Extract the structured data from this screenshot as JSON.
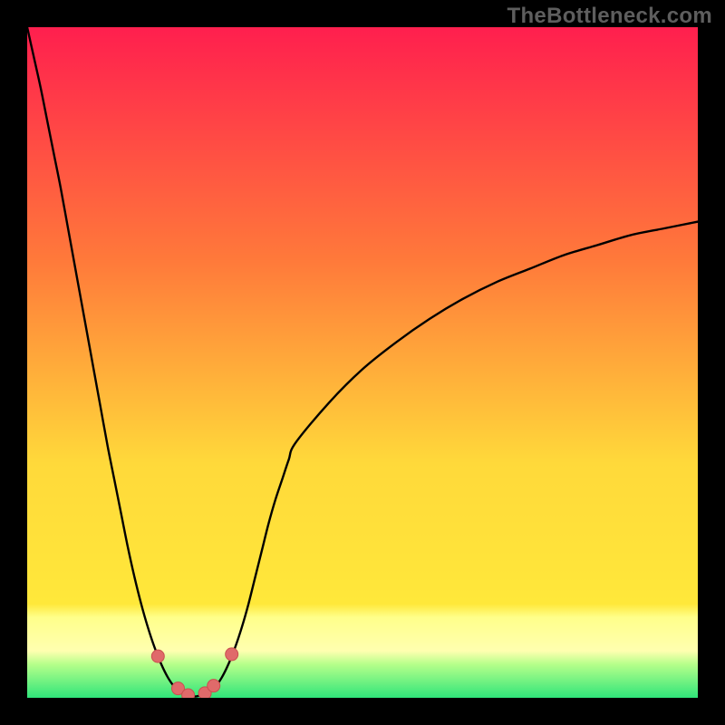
{
  "watermark": "TheBottleneck.com",
  "colors": {
    "frame": "#000000",
    "curve": "#000000",
    "marker_fill": "#e06a6a",
    "marker_stroke": "#c94f4f",
    "gradient_top": "#ff1f4e",
    "gradient_mid1": "#ff7a3a",
    "gradient_mid2": "#ffd93a",
    "gradient_band": "#ffff8a",
    "gradient_green": "#2fe57a"
  },
  "chart_data": {
    "type": "line",
    "title": "",
    "xlabel": "",
    "ylabel": "",
    "xlim": [
      0,
      100
    ],
    "ylim": [
      0,
      100
    ],
    "x": [
      0,
      1,
      2,
      3,
      4,
      5,
      6,
      7,
      8,
      9,
      10,
      11,
      12,
      13,
      14,
      15,
      16,
      17,
      18,
      19,
      20,
      21,
      22,
      23,
      24,
      25,
      26,
      27,
      28,
      29,
      30,
      31,
      32,
      33,
      34,
      35,
      36,
      37,
      38,
      39,
      40,
      45,
      50,
      55,
      60,
      65,
      70,
      75,
      80,
      85,
      90,
      95,
      100
    ],
    "y": [
      100,
      95.5,
      91,
      86,
      81,
      76,
      70.5,
      65,
      59.5,
      54,
      48.5,
      43,
      37.5,
      32.5,
      27.5,
      22.5,
      18,
      14,
      10.5,
      7.5,
      5,
      3,
      1.6,
      0.9,
      0.4,
      0.2,
      0.4,
      0.9,
      1.6,
      3,
      5,
      7.5,
      10.5,
      14,
      18,
      22,
      26,
      29.5,
      32.5,
      35.5,
      38,
      44,
      49,
      53,
      56.5,
      59.5,
      62,
      64,
      66,
      67.5,
      69,
      70,
      71
    ],
    "markers": {
      "x": [
        19.5,
        22.5,
        24,
        26.5,
        27.8,
        30.5
      ],
      "y": [
        6.2,
        1.4,
        0.4,
        0.7,
        1.8,
        6.5
      ]
    },
    "annotations": []
  }
}
